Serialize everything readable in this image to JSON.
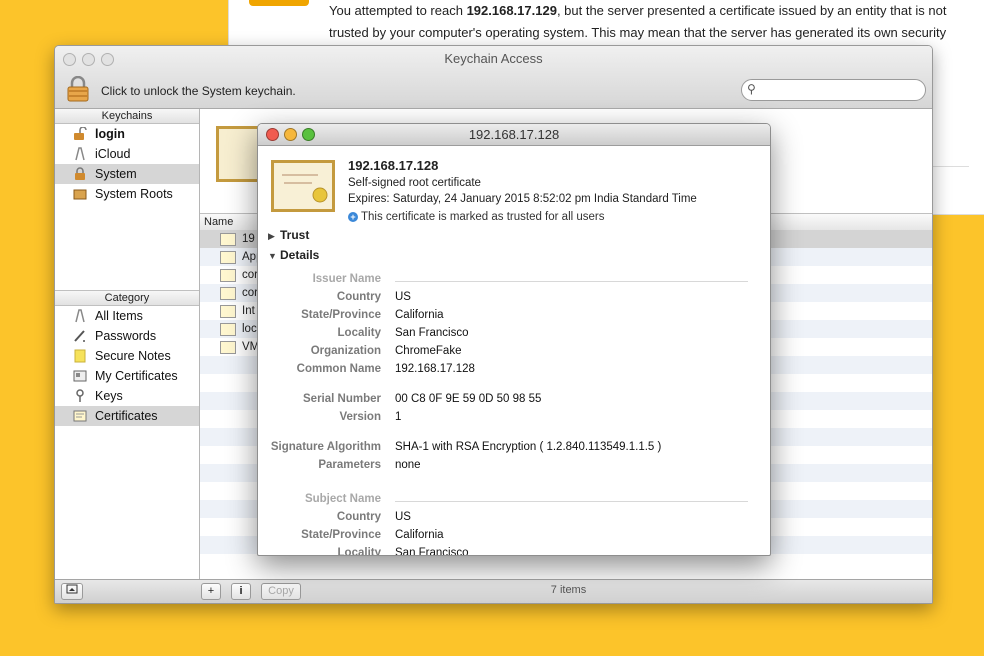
{
  "background_page": {
    "warning_prefix": "You attempted to reach ",
    "warning_host": "192.168.17.129",
    "warning_rest": ", but the server presented a certificate issued by an entity that is not trusted by your computer's operating system. This may mean that the server has generated its own security"
  },
  "keychain_window": {
    "title": "Keychain Access",
    "unlock_label": "Click to unlock the System keychain.",
    "search_placeholder": "",
    "keychains_header": "Keychains",
    "keychains": [
      {
        "label": "login",
        "icon": "lock-open-icon"
      },
      {
        "label": "iCloud",
        "icon": "cloud-keychain-icon"
      },
      {
        "label": "System",
        "icon": "lock-closed-icon"
      },
      {
        "label": "System Roots",
        "icon": "folder-icon"
      }
    ],
    "category_header": "Category",
    "categories": [
      {
        "label": "All Items",
        "icon": "keys-icon"
      },
      {
        "label": "Passwords",
        "icon": "pen-icon"
      },
      {
        "label": "Secure Notes",
        "icon": "note-icon"
      },
      {
        "label": "My Certificates",
        "icon": "id-card-icon"
      },
      {
        "label": "Keys",
        "icon": "key-icon"
      },
      {
        "label": "Certificates",
        "icon": "certificate-icon"
      }
    ],
    "column_name": "Name",
    "rows": [
      "19",
      "App",
      "cor",
      "cor",
      "Int",
      "loc",
      "VM"
    ],
    "item_count": "7 items",
    "copy_button": "Copy",
    "add_button": "+",
    "info_button": "i"
  },
  "cert_window": {
    "title": "192.168.17.128",
    "name": "192.168.17.128",
    "subtitle": "Self-signed root certificate",
    "expires": "Expires: Saturday, 24 January 2015 8:52:02 pm India Standard Time",
    "trusted": "This certificate is marked as trusted for all users",
    "trust_label": "Trust",
    "details_label": "Details",
    "issuer_header": "Issuer Name",
    "issuer": [
      {
        "k": "Country",
        "v": "US"
      },
      {
        "k": "State/Province",
        "v": "California"
      },
      {
        "k": "Locality",
        "v": "San Francisco"
      },
      {
        "k": "Organization",
        "v": "ChromeFake"
      },
      {
        "k": "Common Name",
        "v": "192.168.17.128"
      }
    ],
    "serial_label": "Serial Number",
    "serial_value": "00 C8 0F 9E 59 0D 50 98 55",
    "version_label": "Version",
    "version_value": "1",
    "sigalg_label": "Signature Algorithm",
    "sigalg_value": "SHA-1 with RSA Encryption ( 1.2.840.113549.1.1.5 )",
    "params_label": "Parameters",
    "params_value": "none",
    "subject_header": "Subject Name",
    "subject": [
      {
        "k": "Country",
        "v": "US"
      },
      {
        "k": "State/Province",
        "v": "California"
      },
      {
        "k": "Locality",
        "v": "San Francisco"
      }
    ]
  }
}
